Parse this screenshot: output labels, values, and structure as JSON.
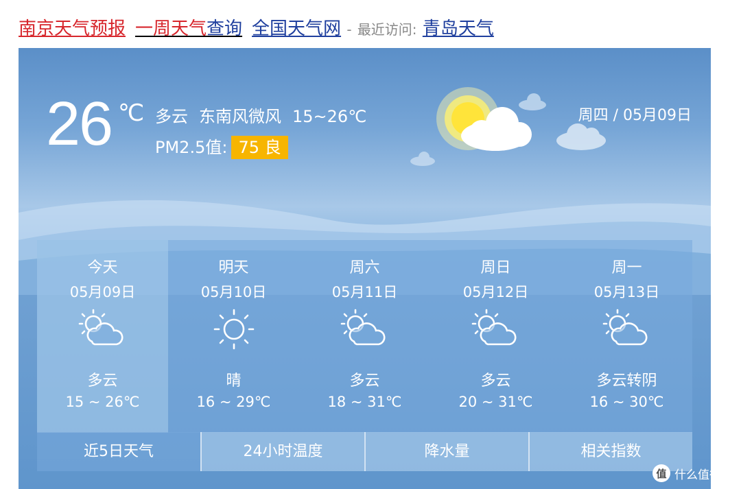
{
  "top_links": {
    "forecast": "南京天气预报",
    "week_prefix": "一周天气",
    "week_suffix": "查询",
    "national": "全国天气网",
    "separator": "-",
    "recent_label": "最近访问:",
    "recent_city": "青岛天气"
  },
  "current": {
    "temperature": "26",
    "unit": "℃",
    "condition": "多云",
    "wind": "东南风微风",
    "range": "15~26℃",
    "pm_label": "PM2.5值:",
    "pm_value": "75 良",
    "date": "周四 / 05月09日",
    "aqi_color": "#f7b500"
  },
  "forecast": [
    {
      "name": "今天",
      "date": "05月09日",
      "icon": "partly-cloudy",
      "condition": "多云",
      "range": "15 ~ 26℃"
    },
    {
      "name": "明天",
      "date": "05月10日",
      "icon": "sunny",
      "condition": "晴",
      "range": "16 ~ 29℃"
    },
    {
      "name": "周六",
      "date": "05月11日",
      "icon": "partly-cloudy",
      "condition": "多云",
      "range": "18 ~ 31℃"
    },
    {
      "name": "周日",
      "date": "05月12日",
      "icon": "partly-cloudy",
      "condition": "多云",
      "range": "20 ~ 31℃"
    },
    {
      "name": "周一",
      "date": "05月13日",
      "icon": "partly-cloudy",
      "condition": "多云转阴",
      "range": "16 ~ 30℃"
    }
  ],
  "tabs": [
    {
      "label": "近5日天气",
      "active": true
    },
    {
      "label": "24小时温度",
      "active": false
    },
    {
      "label": "降水量",
      "active": false
    },
    {
      "label": "相关指数",
      "active": false
    }
  ],
  "watermark": {
    "logo": "值",
    "text": "什么值得买"
  }
}
